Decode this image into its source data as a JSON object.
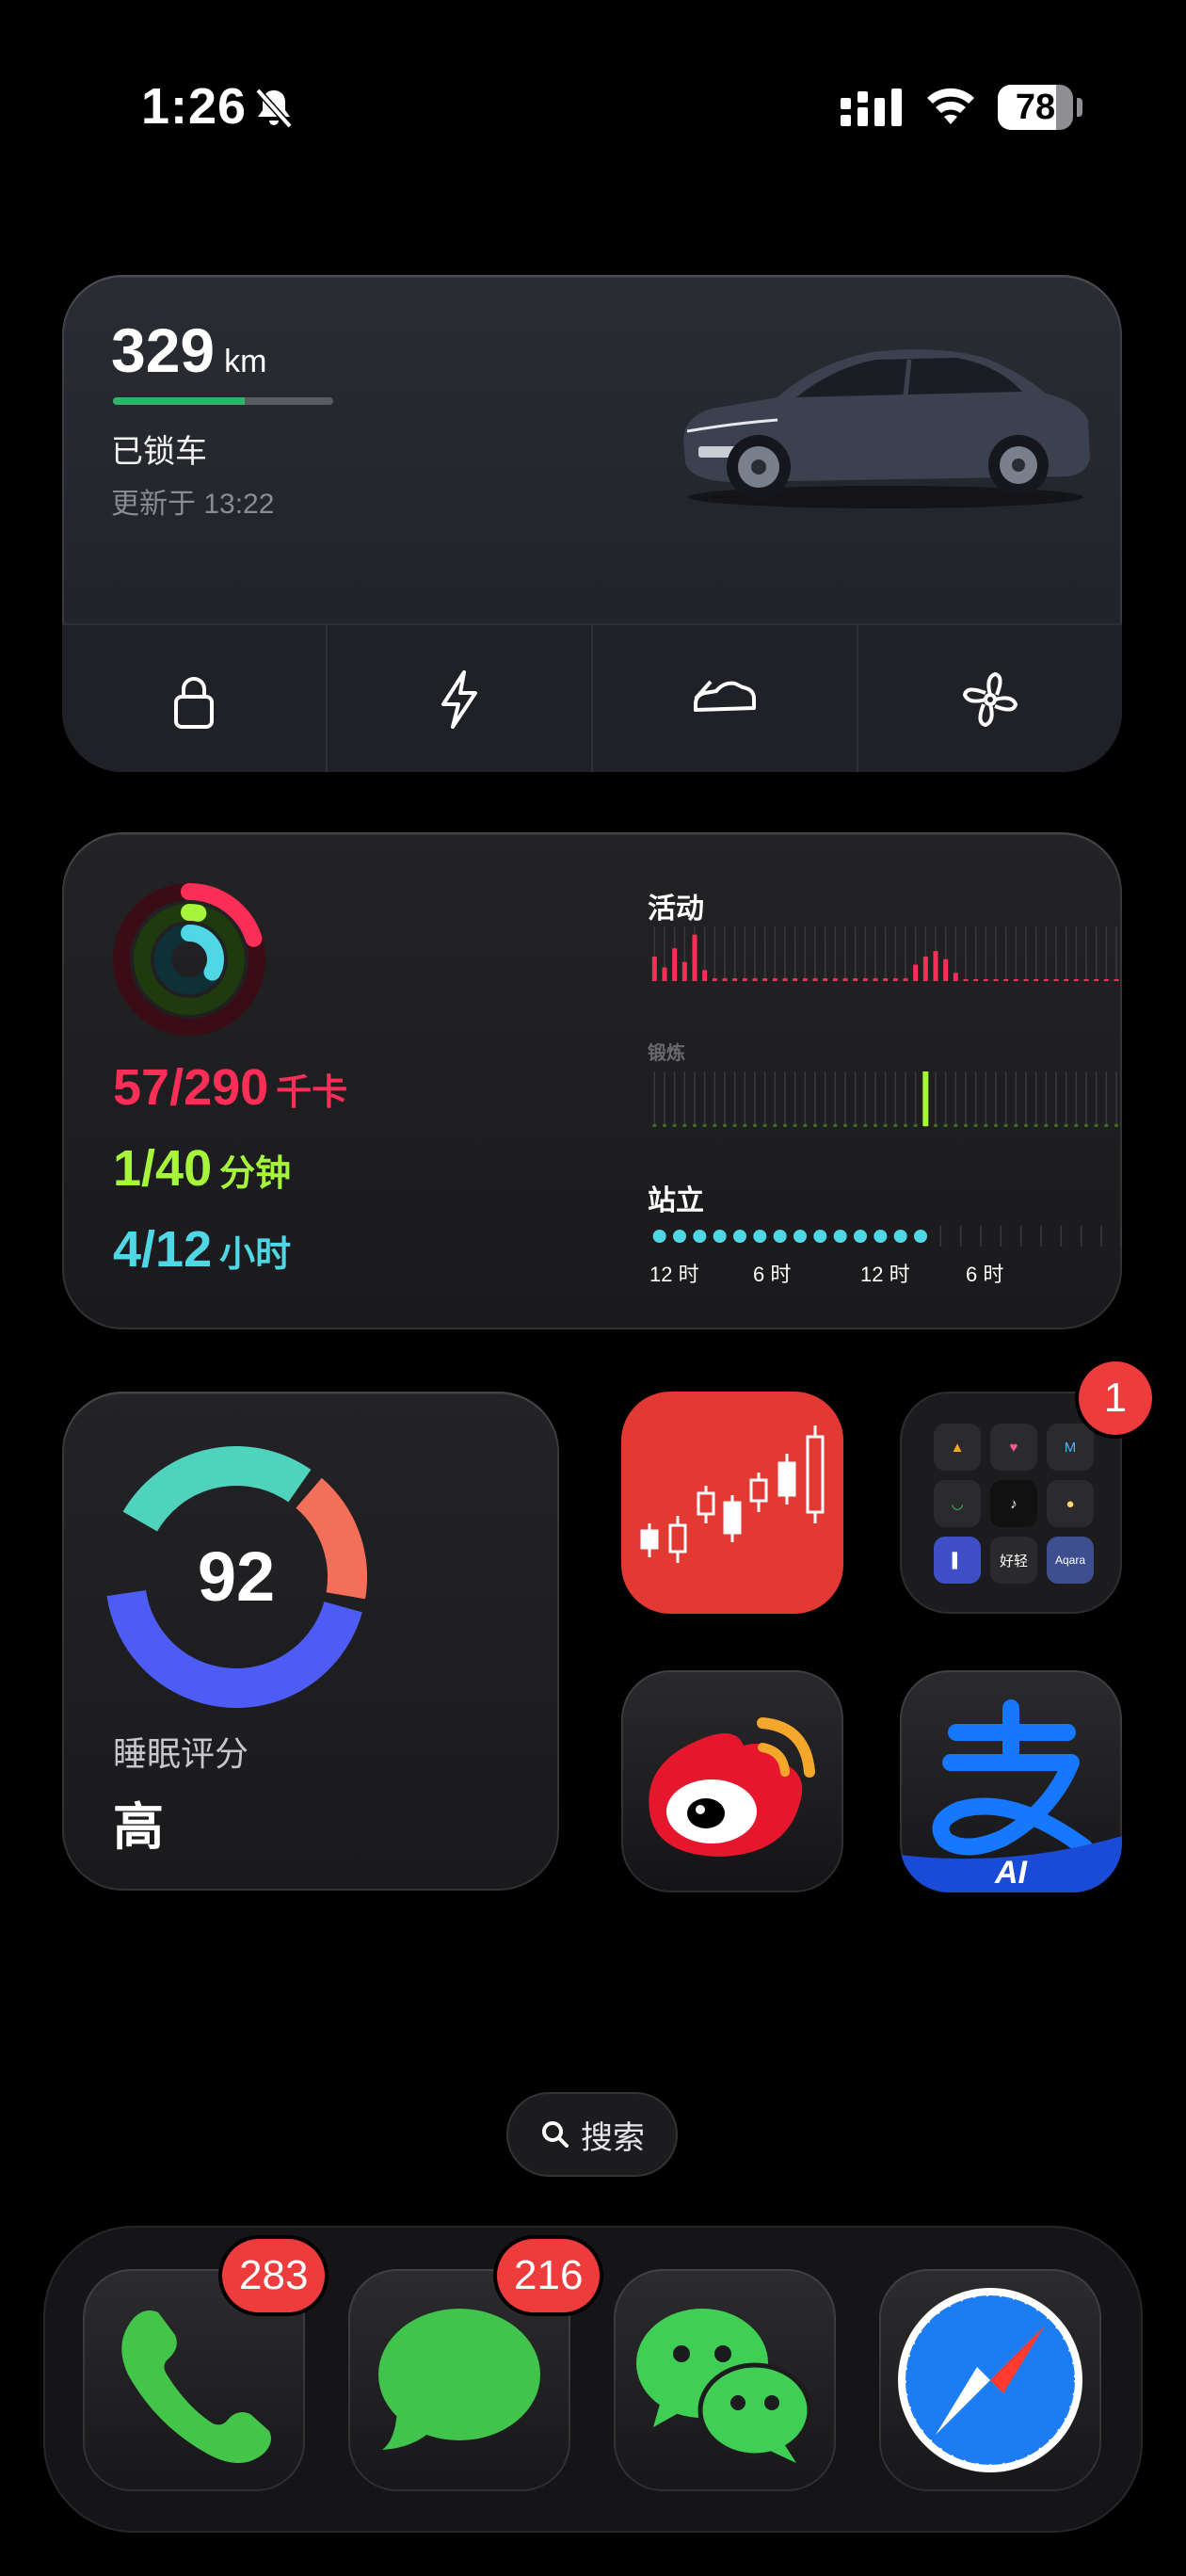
{
  "status_bar": {
    "time": "1:26",
    "battery": "78",
    "battery_level": 0.78,
    "icons": [
      "bell-slash-icon",
      "cellular-signal-icon",
      "wifi-icon",
      "battery-icon"
    ]
  },
  "car_widget": {
    "range_value": "329",
    "range_unit": "km",
    "range_fraction": 0.6,
    "status": "已锁车",
    "updated": "更新于 13:22",
    "controls": [
      "lock-icon",
      "bolt-icon",
      "car-trunk-icon",
      "fan-icon"
    ],
    "accent": "#2fb56a"
  },
  "activity_widget": {
    "move_value": "57/290",
    "move_unit": "千卡",
    "exercise_value": "1/40",
    "exercise_unit": "分钟",
    "stand_value": "4/12",
    "stand_unit": "小时",
    "label_move": "活动",
    "label_exercise": "锻炼",
    "label_stand": "站立",
    "axis_ticks": [
      "12 时",
      "6 时",
      "12 时",
      "6 时"
    ],
    "colors": {
      "move": "#fa2e56",
      "exercise": "#a6f53b",
      "stand": "#4fd7e6"
    },
    "move_hourly": [
      0.45,
      0.25,
      0.6,
      0.35,
      0.85,
      0.2,
      0.05,
      0.05,
      0.05,
      0.05,
      0.05,
      0.05,
      0.05,
      0.05,
      0.05,
      0.05,
      0.05,
      0.05,
      0.05,
      0.05,
      0.05,
      0.05,
      0.05,
      0.05,
      0.05,
      0.05,
      0.3,
      0.45,
      0.55,
      0.4,
      0.15,
      0,
      0,
      0,
      0,
      0,
      0,
      0,
      0,
      0,
      0,
      0,
      0,
      0,
      0,
      0,
      0,
      0
    ],
    "exercise_hourly_peak_index": 27,
    "stand_hours_filled": 14,
    "ring_fractions": {
      "move": 0.2,
      "exercise": 0.03,
      "stand": 0.33
    }
  },
  "sleep_widget": {
    "score": "92",
    "label": "睡眠评分",
    "level": "高",
    "segments": [
      {
        "color": "#4fd3bd",
        "fraction": 0.28
      },
      {
        "color": "#f27059",
        "fraction": 0.18
      },
      {
        "color": "#4d5cf5",
        "fraction": 0.45
      }
    ]
  },
  "apps": {
    "stock": "stock-chart-icon",
    "folder_badge": "1",
    "folder_items": [
      "",
      "",
      "",
      "",
      "",
      "",
      "",
      "好轻",
      "Aqara"
    ],
    "weibo": "weibo-icon",
    "alipay": "alipay-icon",
    "alipay_badge_text": "AI"
  },
  "search": {
    "label": "搜索"
  },
  "dock": {
    "phone_badge": "283",
    "messages_badge": "216",
    "items": [
      "phone-icon",
      "messages-icon",
      "wechat-icon",
      "safari-icon"
    ]
  }
}
